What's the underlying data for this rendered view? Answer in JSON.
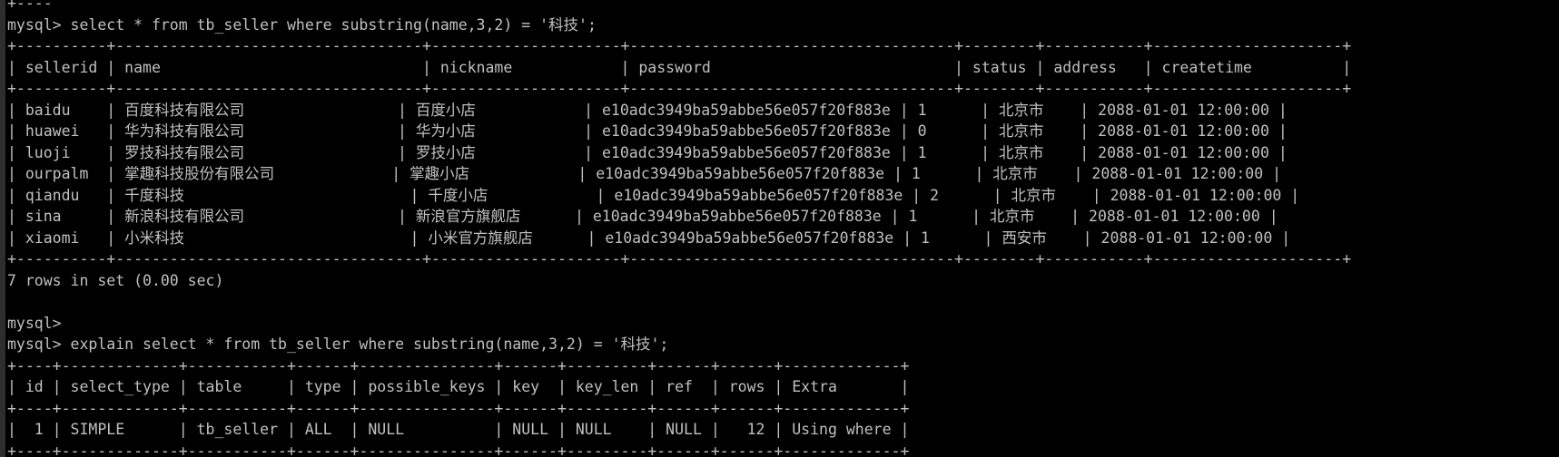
{
  "terminal": {
    "fg_color": "#c0c0c0",
    "bg_color": "#000000",
    "lines": [
      "+----",
      "mysql> select * from tb_seller where substring(name,3,2) = '科技';",
      "+----------+----------------------------------+---------------------+------------------------------------+--------+-----------+---------------------+",
      "| sellerid | name                             | nickname            | password                           | status | address   | createtime          |",
      "+----------+----------------------------------+---------------------+------------------------------------+--------+-----------+---------------------+",
      "| baidu    | 百度科技有限公司                 | 百度小店            | e10adc3949ba59abbe56e057f20f883e | 1      | 北京市    | 2088-01-01 12:00:00 |",
      "| huawei   | 华为科技有限公司                 | 华为小店            | e10adc3949ba59abbe56e057f20f883e | 0      | 北京市    | 2088-01-01 12:00:00 |",
      "| luoji    | 罗技科技有限公司                 | 罗技小店            | e10adc3949ba59abbe56e057f20f883e | 1      | 北京市    | 2088-01-01 12:00:00 |",
      "| ourpalm  | 掌趣科技股份有限公司             | 掌趣小店            | e10adc3949ba59abbe56e057f20f883e | 1      | 北京市    | 2088-01-01 12:00:00 |",
      "| qiandu   | 千度科技                         | 千度小店            | e10adc3949ba59abbe56e057f20f883e | 2      | 北京市    | 2088-01-01 12:00:00 |",
      "| sina     | 新浪科技有限公司                 | 新浪官方旗舰店      | e10adc3949ba59abbe56e057f20f883e | 1      | 北京市    | 2088-01-01 12:00:00 |",
      "| xiaomi   | 小米科技                         | 小米官方旗舰店      | e10adc3949ba59abbe56e057f20f883e | 1      | 西安市    | 2088-01-01 12:00:00 |",
      "+----------+----------------------------------+---------------------+------------------------------------+--------+-----------+---------------------+",
      "7 rows in set (0.00 sec)",
      "",
      "mysql>",
      "mysql> explain select * from tb_seller where substring(name,3,2) = '科技';",
      "+----+-------------+-----------+------+---------------+------+---------+------+------+-------------+",
      "| id | select_type | table     | type | possible_keys | key  | key_len | ref  | rows | Extra       |",
      "+----+-------------+-----------+------+---------------+------+---------+------+------+-------------+",
      "|  1 | SIMPLE      | tb_seller | ALL  | NULL          | NULL | NULL    | NULL |   12 | Using where |",
      "+----+-------------+-----------+------+---------------+------+---------+------+------+-------------+"
    ]
  }
}
